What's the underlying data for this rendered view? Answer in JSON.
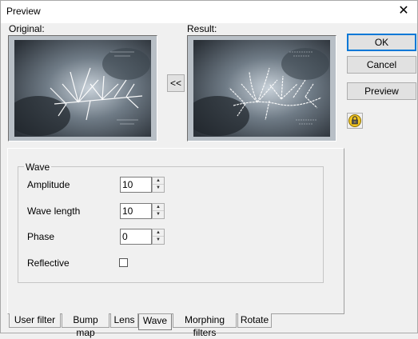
{
  "window": {
    "title": "Preview",
    "close_glyph": "✕"
  },
  "preview": {
    "original_label": "Original:",
    "result_label": "Result:",
    "copy_button": "<<"
  },
  "buttons": {
    "ok": "OK",
    "cancel": "Cancel",
    "preview": "Preview"
  },
  "wave": {
    "group_title": "Wave",
    "amplitude": {
      "label": "Amplitude",
      "value": "10"
    },
    "wave_length": {
      "label": "Wave length",
      "value": "10"
    },
    "phase": {
      "label": "Phase",
      "value": "0"
    },
    "reflective": {
      "label": "Reflective",
      "checked": false
    }
  },
  "tabs": [
    {
      "label": "User filter"
    },
    {
      "label": "Bump map"
    },
    {
      "label": "Lens"
    },
    {
      "label": "Wave",
      "active": true
    },
    {
      "label": "Morphing filters"
    },
    {
      "label": "Rotate"
    }
  ],
  "icons": {
    "lock": "lock-icon",
    "spin_up": "▲",
    "spin_down": "▼"
  }
}
